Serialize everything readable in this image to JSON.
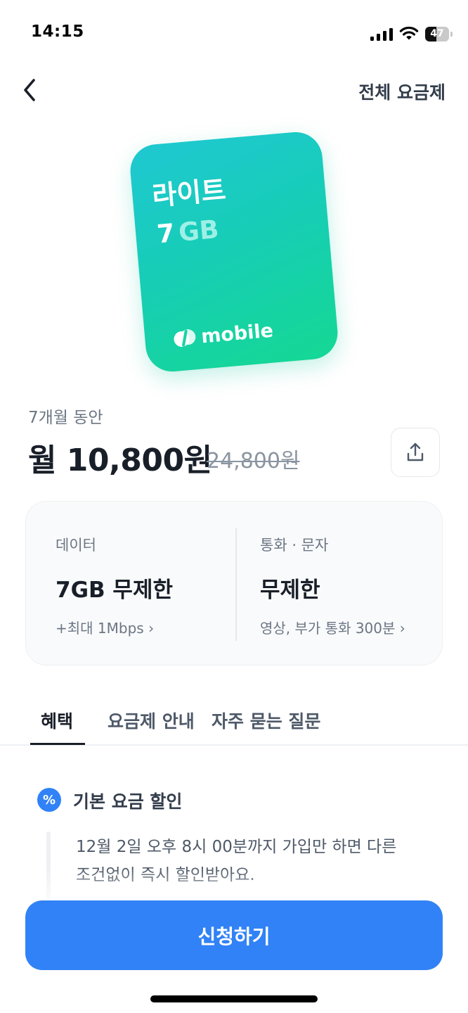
{
  "status_bar": {
    "time": "14:15",
    "battery": "47",
    "battery_level": 0.47
  },
  "nav": {
    "all_plans_label": "전체 요금제"
  },
  "card": {
    "plan_name": "라이트",
    "data_amount": "7",
    "data_unit": "GB",
    "brand": "mobile"
  },
  "pricing": {
    "period": "7개월 동안",
    "price": "월 10,800원",
    "original_price": "24,800원"
  },
  "info": {
    "data": {
      "label": "데이터",
      "value": "7GB 무제한",
      "sub": "+최대 1Mbps ›"
    },
    "call": {
      "label": "통화 · 문자",
      "value": "무제한",
      "sub": "영상, 부가 통화 300분 ›"
    }
  },
  "tabs": [
    {
      "label": "혜택",
      "active": true
    },
    {
      "label": "요금제 안내",
      "active": false
    },
    {
      "label": "자주 묻는 질문",
      "active": false
    }
  ],
  "benefit": {
    "icon": "percent-icon",
    "title": "기본 요금 할인",
    "line1": "12월 2일 오후 8시 00분까지 가입만 하면 다른",
    "line2": "조건없이 즉시 할인받아요."
  },
  "cta": {
    "label": "신청하기"
  },
  "colors": {
    "accent": "#3182f6",
    "card_start": "#1fc8d2",
    "card_end": "#15d893",
    "text_primary": "#191f28",
    "text_secondary": "#6b7684"
  }
}
